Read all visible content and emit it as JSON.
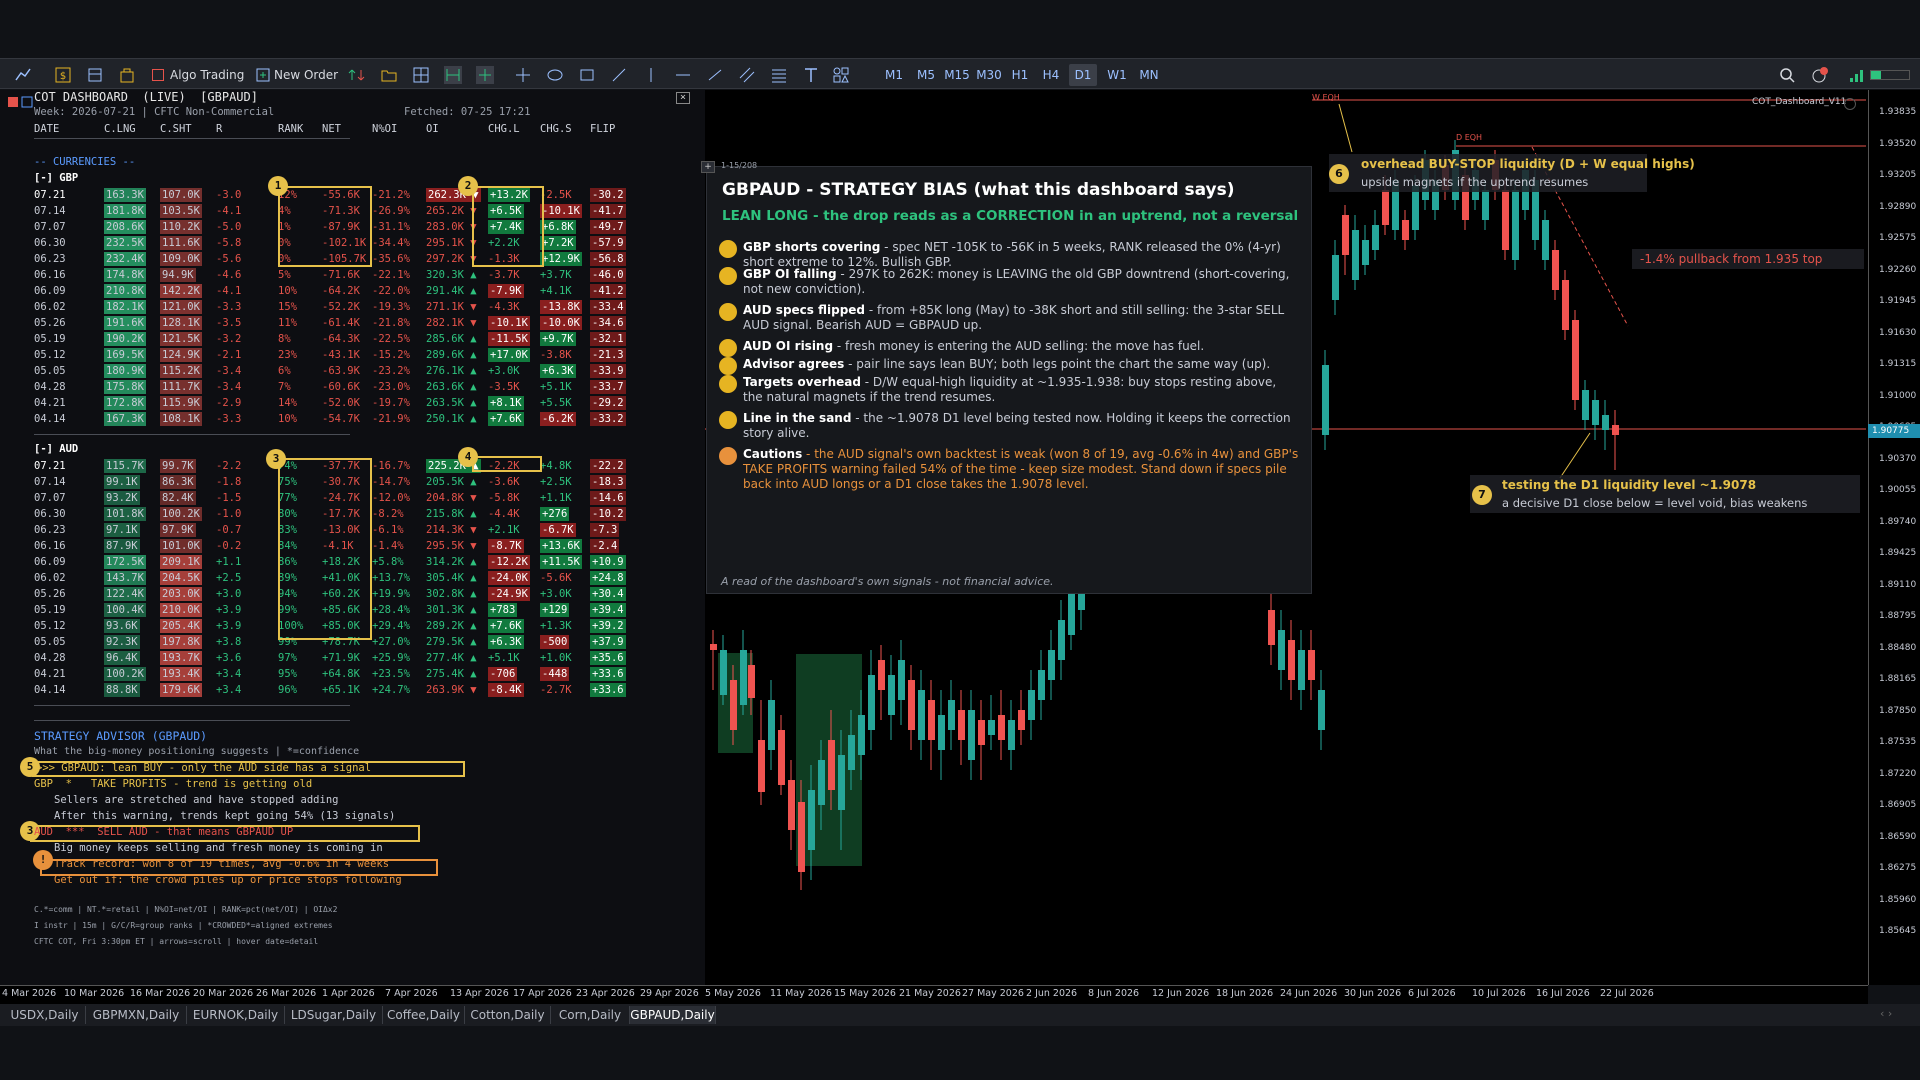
{
  "toolbar": {
    "algo_trading": "Algo Trading",
    "new_order": "New Order",
    "timeframes": [
      "M1",
      "M5",
      "M15",
      "M30",
      "H1",
      "H4",
      "D1",
      "W1",
      "MN"
    ],
    "active_timeframe": "D1"
  },
  "dashboard": {
    "title": "COT DASHBOARD  (LIVE)  [GBPAUD]",
    "week": "Week: 2026-07-21 | CFTC Non-Commercial",
    "fetched": "Fetched: 07-25 17:21",
    "headers": [
      "DATE",
      "C.LNG",
      "C.SHT",
      "R",
      "RANK",
      "NET",
      "N%OI",
      "OI",
      "CHG.L",
      "CHG.S",
      "FLIP"
    ],
    "section": "-- CURRENCIES --",
    "gbp_label": "[-] GBP",
    "aud_label": "[-] AUD",
    "gbp_rows": [
      [
        "07.21",
        "163.3K",
        "107.0K",
        "-3.0",
        "12%",
        "-55.6K",
        "-21.2%",
        "262.3K ▼",
        "+13.2K",
        "-2.5K",
        "-30.2"
      ],
      [
        "07.14",
        "181.8K",
        "103.5K",
        "-4.1",
        "4%",
        "-71.3K",
        "-26.9%",
        "265.2K ▼",
        "+6.5K",
        "-10.1K",
        "-41.7"
      ],
      [
        "07.07",
        "208.6K",
        "110.2K",
        "-5.0",
        "1%",
        "-87.9K",
        "-31.1%",
        "283.0K ▼",
        "+7.4K",
        "+6.8K",
        "-49.7"
      ],
      [
        "06.30",
        "232.5K",
        "111.6K",
        "-5.8",
        "0%",
        "-102.1K",
        "-34.4%",
        "295.1K ▼",
        "+2.2K",
        "+7.2K",
        "-57.9"
      ],
      [
        "06.23",
        "232.4K",
        "109.0K",
        "-5.6",
        "0%",
        "-105.7K",
        "-35.6%",
        "297.2K ▼",
        "-1.3K",
        "+12.9K",
        "-56.8"
      ],
      [
        "06.16",
        "174.8K",
        "94.9K",
        "-4.6",
        "5%",
        "-71.6K",
        "-22.1%",
        "320.3K ▲",
        "-3.7K",
        "+3.7K",
        "-46.0"
      ],
      [
        "06.09",
        "210.8K",
        "142.2K",
        "-4.1",
        "10%",
        "-64.2K",
        "-22.0%",
        "291.4K ▲",
        "-7.9K",
        "+4.1K",
        "-41.2"
      ],
      [
        "06.02",
        "182.1K",
        "121.0K",
        "-3.3",
        "15%",
        "-52.2K",
        "-19.3%",
        "271.1K ▼",
        "-4.3K",
        "-13.8K",
        "-33.4"
      ],
      [
        "05.26",
        "191.6K",
        "128.1K",
        "-3.5",
        "11%",
        "-61.4K",
        "-21.8%",
        "282.1K ▼",
        "-10.1K",
        "-10.0K",
        "-34.6"
      ],
      [
        "05.19",
        "190.2K",
        "121.5K",
        "-3.2",
        "8%",
        "-64.3K",
        "-22.5%",
        "285.6K ▲",
        "-11.5K",
        "+9.7K",
        "-32.1"
      ],
      [
        "05.12",
        "169.5K",
        "124.9K",
        "-2.1",
        "23%",
        "-43.1K",
        "-15.2%",
        "289.6K ▲",
        "+17.0K",
        "-3.8K",
        "-21.3"
      ],
      [
        "05.05",
        "180.9K",
        "115.2K",
        "-3.4",
        "6%",
        "-63.9K",
        "-23.2%",
        "276.1K ▲",
        "+3.0K",
        "+6.3K",
        "-33.9"
      ],
      [
        "04.28",
        "175.8K",
        "111.7K",
        "-3.4",
        "7%",
        "-60.6K",
        "-23.0%",
        "263.6K ▲",
        "-3.5K",
        "+5.1K",
        "-33.7"
      ],
      [
        "04.21",
        "172.8K",
        "115.9K",
        "-2.9",
        "14%",
        "-52.0K",
        "-19.7%",
        "263.5K ▲",
        "+8.1K",
        "+5.5K",
        "-29.2"
      ],
      [
        "04.14",
        "167.3K",
        "108.1K",
        "-3.3",
        "10%",
        "-54.7K",
        "-21.9%",
        "250.1K ▲",
        "+7.6K",
        "-6.2K",
        "-33.2"
      ]
    ],
    "aud_rows": [
      [
        "07.21",
        "115.7K",
        "99.7K",
        "-2.2",
        "74%",
        "-37.7K",
        "-16.7%",
        "225.2K ▲",
        "-2.2K",
        "+4.8K",
        "-22.2"
      ],
      [
        "07.14",
        "99.1K",
        "86.3K",
        "-1.8",
        "75%",
        "-30.7K",
        "-14.7%",
        "205.5K ▲",
        "-3.6K",
        "+2.5K",
        "-18.3"
      ],
      [
        "07.07",
        "93.2K",
        "82.4K",
        "-1.5",
        "77%",
        "-24.7K",
        "-12.0%",
        "204.8K ▼",
        "-5.8K",
        "+1.1K",
        "-14.6"
      ],
      [
        "06.30",
        "101.8K",
        "100.2K",
        "-1.0",
        "80%",
        "-17.7K",
        "-8.2%",
        "215.8K ▲",
        "-4.4K",
        "+276",
        "-10.2"
      ],
      [
        "06.23",
        "97.1K",
        "97.9K",
        "-0.7",
        "83%",
        "-13.0K",
        "-6.1%",
        "214.3K ▼",
        "+2.1K",
        "-6.7K",
        "-7.3"
      ],
      [
        "06.16",
        "87.9K",
        "101.0K",
        "-0.2",
        "84%",
        "-4.1K",
        "-1.4%",
        "295.5K ▼",
        "-8.7K",
        "+13.6K",
        "-2.4"
      ],
      [
        "06.09",
        "172.5K",
        "209.1K",
        "+1.1",
        "86%",
        "+18.2K",
        "+5.8%",
        "314.2K ▲",
        "-12.2K",
        "+11.5K",
        "+10.9"
      ],
      [
        "06.02",
        "143.7K",
        "204.5K",
        "+2.5",
        "89%",
        "+41.0K",
        "+13.7%",
        "305.4K ▲",
        "-24.0K",
        "-5.6K",
        "+24.8"
      ],
      [
        "05.26",
        "122.4K",
        "203.0K",
        "+3.0",
        "94%",
        "+60.2K",
        "+19.9%",
        "302.8K ▲",
        "-24.9K",
        "+3.0K",
        "+30.4"
      ],
      [
        "05.19",
        "100.4K",
        "210.0K",
        "+3.9",
        "99%",
        "+85.6K",
        "+28.4%",
        "301.3K ▲",
        "+783",
        "+129",
        "+39.4"
      ],
      [
        "05.12",
        "93.6K",
        "205.4K",
        "+3.9",
        "100%",
        "+85.0K",
        "+29.4%",
        "289.2K ▲",
        "+7.6K",
        "+1.3K",
        "+39.2"
      ],
      [
        "05.05",
        "92.3K",
        "197.8K",
        "+3.8",
        "99%",
        "+78.7K",
        "+27.0%",
        "279.5K ▲",
        "+6.3K",
        "-500",
        "+37.9"
      ],
      [
        "04.28",
        "96.4K",
        "193.7K",
        "+3.6",
        "97%",
        "+71.9K",
        "+25.9%",
        "277.4K ▲",
        "+5.1K",
        "+1.0K",
        "+35.6"
      ],
      [
        "04.21",
        "100.2K",
        "193.4K",
        "+3.4",
        "95%",
        "+64.8K",
        "+23.5%",
        "275.4K ▲",
        "-706",
        "-448",
        "+33.6"
      ],
      [
        "04.14",
        "88.8K",
        "179.6K",
        "+3.4",
        "96%",
        "+65.1K",
        "+24.7%",
        "263.9K ▼",
        "-8.4K",
        "-2.7K",
        "+33.6"
      ]
    ],
    "advisor_title": "STRATEGY ADVISOR  (GBPAUD)",
    "advisor_sub": "What the big-money positioning suggests | *=confidence",
    "advisor_main": ">>> GBPAUD: lean BUY - only the AUD side has a signal",
    "gbp_line": "GBP  *   TAKE PROFITS - trend is getting old",
    "gbp_detail1": "Sellers are stretched and have stopped adding",
    "gbp_detail2": "After this warning, trends kept going 54% (13 signals)",
    "aud_line": "AUD  ***  SELL AUD - that means GBPAUD UP",
    "aud_detail1": "Big money keeps selling and fresh money is coming in",
    "aud_detail2": "Track record: won 8 of 19 times, avg -0.6% in 4 weeks",
    "aud_detail3": "Get out if: the crowd piles up or price stops following",
    "legend1": "C.*=comm | NT.*=retail | N%OI=net/OI | RANK=pct(net/OI) | OIΔx2",
    "legend2": "I instr | 15m | G/C/R=group ranks | *CROWDED*=aligned extremes",
    "legend3": "CFTC COT, Fri 3:30pm ET | arrows=scroll | hover date=detail"
  },
  "info": {
    "pages": "1-15/208",
    "title": "GBPAUD - STRATEGY BIAS (what this dashboard says)",
    "subtitle": "LEAN LONG - the drop reads as a CORRECTION in an uptrend, not a reversal",
    "items": [
      {
        "head": "GBP shorts covering",
        "text": " - spec NET -105K to -56K in 5 weeks, RANK released the 0% (4-yr) short extreme to 12%. Bullish GBP."
      },
      {
        "head": "GBP OI falling",
        "text": " - 297K to 262K: money is LEAVING the old GBP downtrend (short-covering, not new conviction)."
      },
      {
        "head": "AUD specs flipped",
        "text": " - from +85K long (May) to -38K short and still selling: the 3-star SELL AUD signal. Bearish AUD = GBPAUD up."
      },
      {
        "head": "AUD OI rising",
        "text": " - fresh money is entering the AUD selling: the move has fuel."
      },
      {
        "head": "Advisor agrees",
        "text": " - pair line says lean BUY; both legs point the chart the same way (up)."
      },
      {
        "head": "Targets overhead",
        "text": " - D/W equal-high liquidity at ~1.935-1.938: buy stops resting above, the natural magnets if the trend resumes."
      },
      {
        "head": "Line in the sand",
        "text": " - the ~1.9078 D1 level being tested now. Holding it keeps the correction story alive."
      },
      {
        "head": "Cautions",
        "text": " - the AUD signal's own backtest is weak (won 8 of 19, avg -0.6% in 4w) and GBP's TAKE PROFITS warning failed 54% of the time - keep size modest. Stand down if specs pile back into AUD longs or a D1 close takes the 1.9078 level."
      }
    ],
    "footer": "A read of the dashboard's own signals - not financial advice."
  },
  "annotations": {
    "a6_title": "overhead BUY-STOP liquidity (D + W equal highs)",
    "a6_sub": "upside magnets if the uptrend resumes",
    "pullback": "-1.4% pullback from 1.935 top",
    "a7_title": "testing the D1 liquidity level ~1.9078",
    "a7_sub": "a decisive D1 close below = level void, bias weakens",
    "w_eqh": "W EQH",
    "d_eqh": "D EQH",
    "indicator": "COT_Dashboard_V11",
    "price_tag": "1.90775",
    "nums": [
      "1",
      "2",
      "3",
      "4",
      "5",
      "3",
      "!",
      "6",
      "7"
    ]
  },
  "yaxis": [
    "1.93835",
    "1.93520",
    "1.93205",
    "1.92890",
    "1.92575",
    "1.92260",
    "1.91945",
    "1.91630",
    "1.91315",
    "1.91000",
    "1.90685",
    "1.90370",
    "1.90055",
    "1.89740",
    "1.89425",
    "1.89110",
    "1.88795",
    "1.88480",
    "1.88165",
    "1.87850",
    "1.87535",
    "1.87220",
    "1.86905",
    "1.86590",
    "1.86275",
    "1.85960",
    "1.85645"
  ],
  "xaxis": [
    "4 Mar 2026",
    "10 Mar 2026",
    "16 Mar 2026",
    "20 Mar 2026",
    "26 Mar 2026",
    "1 Apr 2026",
    "7 Apr 2026",
    "13 Apr 2026",
    "17 Apr 2026",
    "23 Apr 2026",
    "29 Apr 2026",
    "5 May 2026",
    "11 May 2026",
    "15 May 2026",
    "21 May 2026",
    "27 May 2026",
    "2 Jun 2026",
    "8 Jun 2026",
    "12 Jun 2026",
    "18 Jun 2026",
    "24 Jun 2026",
    "30 Jun 2026",
    "6 Jul 2026",
    "10 Jul 2026",
    "16 Jul 2026",
    "22 Jul 2026"
  ],
  "tabs": [
    "USDX,Daily",
    "GBPMXN,Daily",
    "EURNOK,Daily",
    "LDSugar,Daily",
    "Coffee,Daily",
    "Cotton,Daily",
    "Corn,Daily",
    "GBPAUD,Daily"
  ],
  "active_tab": "GBPAUD,Daily"
}
